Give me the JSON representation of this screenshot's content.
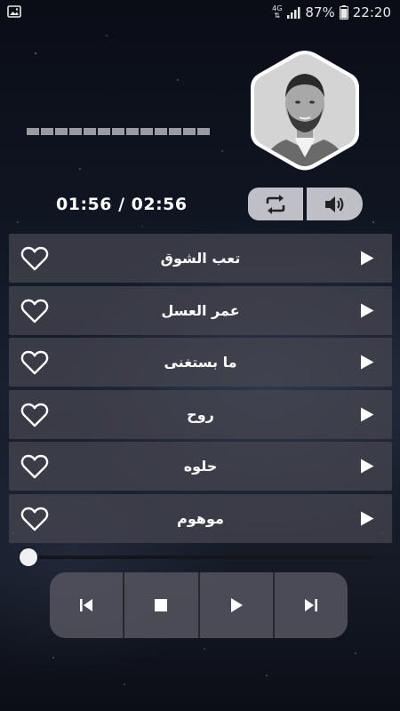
{
  "status_bar": {
    "network": "4G",
    "battery": "87%",
    "time": "22:20"
  },
  "player": {
    "equalizer_bar_count": 13,
    "time_display": "01:56 / 02:56",
    "progress_fraction": 0.0
  },
  "songs": [
    {
      "title": "تعب الشوق"
    },
    {
      "title": "عمر العسل"
    },
    {
      "title": "ما بستغنى"
    },
    {
      "title": "روح"
    },
    {
      "title": "حلوه"
    },
    {
      "title": "موهوم"
    }
  ],
  "icons": {
    "status_left": "gallery-icon",
    "repeat": "repeat-icon",
    "volume": "volume-icon",
    "favorite": "heart-outline-icon",
    "row_play": "play-icon",
    "prev": "skip-previous-icon",
    "stop": "stop-icon",
    "play": "play-icon",
    "next": "skip-next-icon"
  },
  "colors": {
    "row_background": "#46464f",
    "control_background": "#e6e6eb",
    "text": "#ffffff"
  }
}
